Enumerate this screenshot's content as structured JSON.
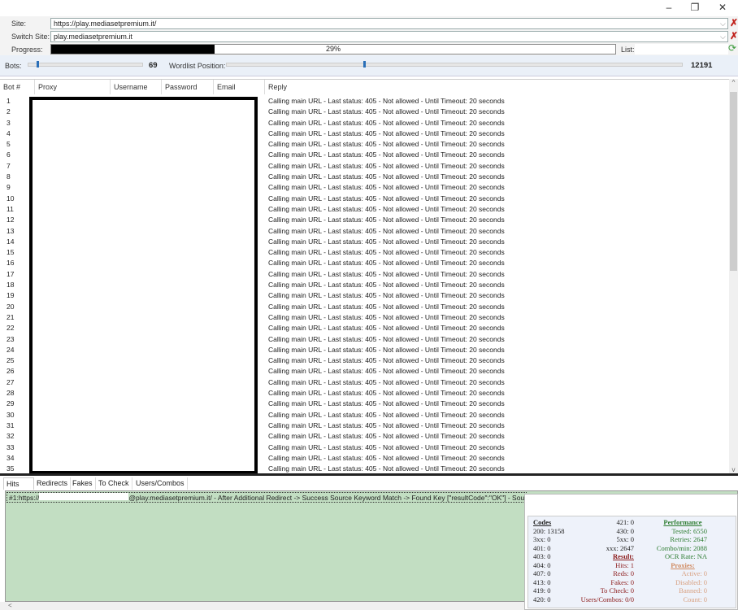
{
  "window": {
    "minimize": "–",
    "restore": "❐",
    "close": "✕"
  },
  "site": {
    "label": "Site:",
    "value": "https://play.mediasetpremium.it/"
  },
  "switch_site": {
    "label": "Switch Site:",
    "value": "play.mediasetpremium.it"
  },
  "progress": {
    "label": "Progress:",
    "percent": 29,
    "text": "29%"
  },
  "list": {
    "label": "List:"
  },
  "bots": {
    "label": "Bots:",
    "value": "69",
    "slider_fraction": 0.07
  },
  "wordlist": {
    "label": "Wordlist Position:",
    "value": "12191",
    "slider_fraction": 0.3
  },
  "table": {
    "columns": [
      "Bot #",
      "Proxy",
      "Username",
      "Password",
      "Email",
      "Reply"
    ],
    "rows": [
      {
        "bot": "1",
        "reply": "Calling main URL - Last status: 405 - Not allowed - Until Timeout: 20 seconds"
      },
      {
        "bot": "2",
        "reply": "Calling main URL - Last status: 405 - Not allowed - Until Timeout: 20 seconds"
      },
      {
        "bot": "3",
        "reply": "Calling main URL - Last status: 405 - Not allowed - Until Timeout: 20 seconds"
      },
      {
        "bot": "4",
        "reply": "Calling main URL - Last status: 405 - Not allowed - Until Timeout: 20 seconds"
      },
      {
        "bot": "5",
        "reply": "Calling main URL - Last status: 405 - Not allowed - Until Timeout: 20 seconds"
      },
      {
        "bot": "6",
        "reply": "Calling main URL - Last status: 405 - Not allowed - Until Timeout: 20 seconds"
      },
      {
        "bot": "7",
        "reply": "Calling main URL - Last status: 405 - Not allowed - Until Timeout: 20 seconds"
      },
      {
        "bot": "8",
        "reply": "Calling main URL - Last status: 405 - Not allowed - Until Timeout: 20 seconds"
      },
      {
        "bot": "9",
        "reply": "Calling main URL - Last status: 405 - Not allowed - Until Timeout: 20 seconds"
      },
      {
        "bot": "10",
        "reply": "Calling main URL - Last status: 405 - Not allowed - Until Timeout: 20 seconds"
      },
      {
        "bot": "11",
        "reply": "Calling main URL - Last status: 405 - Not allowed - Until Timeout: 20 seconds"
      },
      {
        "bot": "12",
        "reply": "Calling main URL - Last status: 405 - Not allowed - Until Timeout: 20 seconds"
      },
      {
        "bot": "13",
        "reply": "Calling main URL - Last status: 405 - Not allowed - Until Timeout: 20 seconds"
      },
      {
        "bot": "14",
        "reply": "Calling main URL - Last status: 405 - Not allowed - Until Timeout: 20 seconds"
      },
      {
        "bot": "15",
        "reply": "Calling main URL - Last status: 405 - Not allowed - Until Timeout: 20 seconds"
      },
      {
        "bot": "16",
        "reply": "Calling main URL - Last status: 405 - Not allowed - Until Timeout: 20 seconds"
      },
      {
        "bot": "17",
        "reply": "Calling main URL - Last status: 405 - Not allowed - Until Timeout: 20 seconds"
      },
      {
        "bot": "18",
        "reply": "Calling main URL - Last status: 405 - Not allowed - Until Timeout: 20 seconds"
      },
      {
        "bot": "19",
        "reply": "Calling main URL - Last status: 405 - Not allowed - Until Timeout: 20 seconds"
      },
      {
        "bot": "20",
        "reply": "Calling main URL - Last status: 405 - Not allowed - Until Timeout: 20 seconds"
      },
      {
        "bot": "21",
        "reply": "Calling main URL - Last status: 405 - Not allowed - Until Timeout: 20 seconds"
      },
      {
        "bot": "22",
        "reply": "Calling main URL - Last status: 405 - Not allowed - Until Timeout: 20 seconds"
      },
      {
        "bot": "23",
        "reply": "Calling main URL - Last status: 405 - Not allowed - Until Timeout: 20 seconds"
      },
      {
        "bot": "24",
        "reply": "Calling main URL - Last status: 405 - Not allowed - Until Timeout: 20 seconds"
      },
      {
        "bot": "25",
        "reply": "Calling main URL - Last status: 405 - Not allowed - Until Timeout: 20 seconds"
      },
      {
        "bot": "26",
        "reply": "Calling main URL - Last status: 405 - Not allowed - Until Timeout: 20 seconds"
      },
      {
        "bot": "27",
        "reply": "Calling main URL - Last status: 405 - Not allowed - Until Timeout: 20 seconds"
      },
      {
        "bot": "28",
        "reply": "Calling main URL - Last status: 405 - Not allowed - Until Timeout: 20 seconds"
      },
      {
        "bot": "29",
        "reply": "Calling main URL - Last status: 405 - Not allowed - Until Timeout: 20 seconds"
      },
      {
        "bot": "30",
        "reply": "Calling main URL - Last status: 405 - Not allowed - Until Timeout: 20 seconds"
      },
      {
        "bot": "31",
        "reply": "Calling main URL - Last status: 405 - Not allowed - Until Timeout: 20 seconds"
      },
      {
        "bot": "32",
        "reply": "Calling main URL - Last status: 405 - Not allowed - Until Timeout: 20 seconds"
      },
      {
        "bot": "33",
        "reply": "Calling main URL - Last status: 405 - Not allowed - Until Timeout: 20 seconds"
      },
      {
        "bot": "34",
        "reply": "Calling main URL - Last status: 405 - Not allowed - Until Timeout: 20 seconds"
      },
      {
        "bot": "35",
        "reply": "Calling main URL - Last status: 405 - Not allowed - Until Timeout: 20 seconds"
      }
    ]
  },
  "tabs": [
    "Hits",
    "Redirects",
    "Fakes",
    "To Check",
    "Users/Combos"
  ],
  "hits": {
    "line_prefix": "#1:https://",
    "line_rest": "@play.mediasetpremium.it/ - After Additional Redirect -> Success Source Keyword Match -> Found Key [\"resultCode\":\"OK\"] - Sou"
  },
  "stats": {
    "codes": {
      "title": "Codes",
      "items": [
        "200: 13158",
        "3xx: 0",
        "401: 0",
        "403: 0",
        "404: 0",
        "407: 0",
        "413: 0",
        "419: 0",
        "420: 0"
      ]
    },
    "codes2": [
      "421: 0",
      "430: 0",
      "5xx: 0",
      "xxx: 2647"
    ],
    "result": {
      "title": "Result:",
      "items": [
        "Hits: 1",
        "Reds: 0",
        "Fakes: 0",
        "To Check: 0",
        "Users/Combos: 0/0"
      ]
    },
    "performance": {
      "title": "Performance",
      "items": [
        "Tested: 6550",
        "Retries: 2647",
        "Combo/min: 2088",
        "OCR Rate: NA"
      ]
    },
    "proxies": {
      "title": "Proxies:",
      "items": [
        "Active: 0",
        "Disabled: 0",
        "Banned: 0",
        "Count: 0"
      ]
    }
  },
  "colors": {
    "hits_bg": "#c2dec2",
    "performance": "#2e7d32",
    "result": "#8b1a1a",
    "proxies": "#d08a60",
    "progress_fill": "#000000"
  }
}
